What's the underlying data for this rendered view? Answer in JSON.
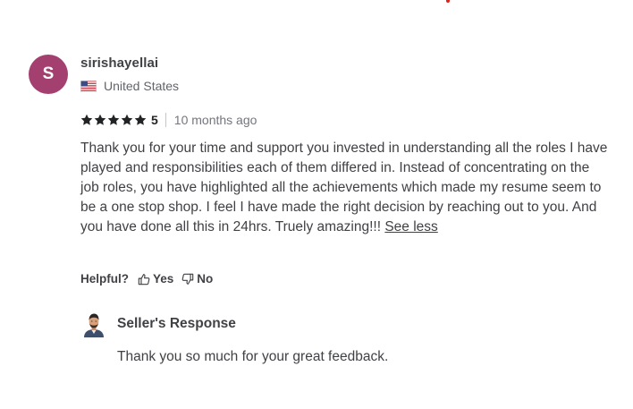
{
  "reviewer": {
    "avatar_initial": "S",
    "username": "sirishayellai",
    "country": "United States",
    "flag_icon": "us-flag-icon"
  },
  "rating": {
    "stars": 5,
    "value": "5",
    "time_ago": "10 months ago"
  },
  "review": {
    "text": "Thank you for your time and support you invested in understanding all the roles I have played and responsibilities each of them differed in. Instead of concentrating on the job roles, you have highlighted all the achievements which made my resume seem to be a one stop shop. I feel I have made the right decision by reaching out to you. And you have done all this in 24hrs. Truely amazing!!!",
    "see_less_label": "See less"
  },
  "helpful": {
    "label": "Helpful?",
    "yes_label": "Yes",
    "no_label": "No"
  },
  "seller_response": {
    "title": "Seller's Response",
    "text": "Thank you so much for your great feedback."
  },
  "colors": {
    "avatar_bg": "#a3406f",
    "star": "#222325",
    "text": "#404145",
    "muted": "#74767e"
  }
}
